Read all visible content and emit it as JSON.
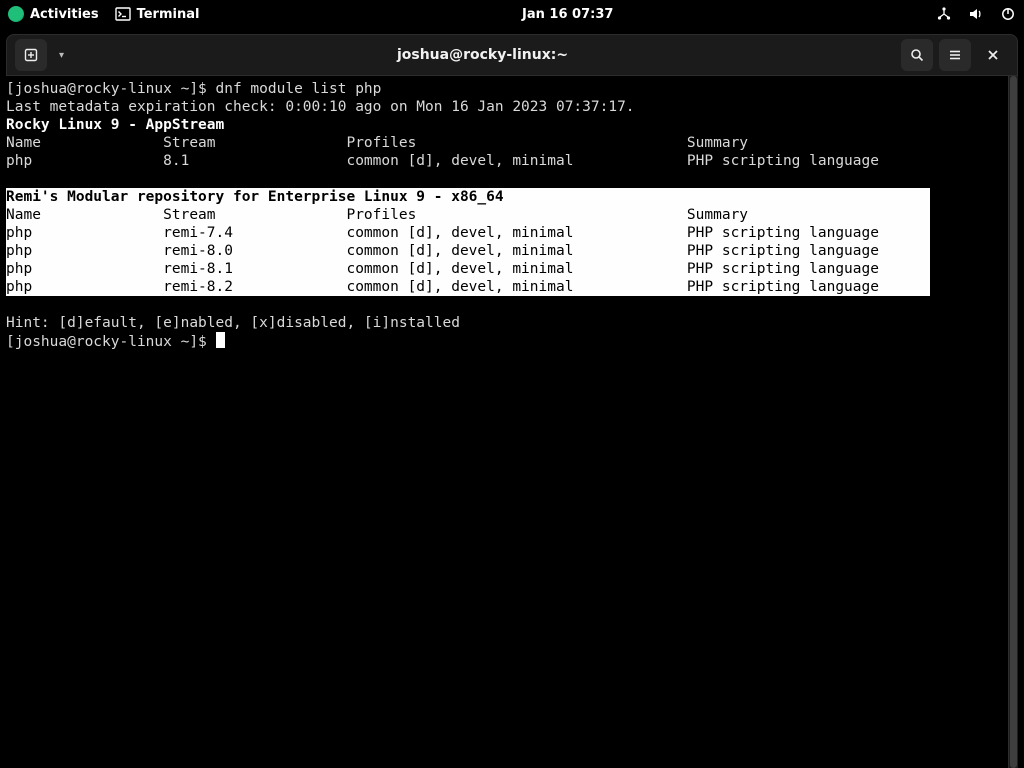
{
  "topbar": {
    "activities": "Activities",
    "terminal_label": "Terminal",
    "clock": "Jan 16  07:37"
  },
  "window": {
    "title": "joshua@rocky-linux:~"
  },
  "term": {
    "prompt": "[joshua@rocky-linux ~]$ ",
    "command": "dnf module list php",
    "meta_line": "Last metadata expiration check: 0:00:10 ago on Mon 16 Jan 2023 07:37:17.",
    "repo1_title": "Rocky Linux 9 - AppStream",
    "headers": {
      "name": "Name",
      "stream": "Stream",
      "profiles": "Profiles",
      "summary": "Summary"
    },
    "repo1_rows": [
      {
        "name": "php",
        "stream": "8.1",
        "profiles": "common [d], devel, minimal",
        "summary": "PHP scripting language"
      }
    ],
    "repo2_title": "Remi's Modular repository for Enterprise Linux 9 - x86_64",
    "repo2_rows": [
      {
        "name": "php",
        "stream": "remi-7.4",
        "profiles": "common [d], devel, minimal",
        "summary": "PHP scripting language"
      },
      {
        "name": "php",
        "stream": "remi-8.0",
        "profiles": "common [d], devel, minimal",
        "summary": "PHP scripting language"
      },
      {
        "name": "php",
        "stream": "remi-8.1",
        "profiles": "common [d], devel, minimal",
        "summary": "PHP scripting language"
      },
      {
        "name": "php",
        "stream": "remi-8.2",
        "profiles": "common [d], devel, minimal",
        "summary": "PHP scripting language"
      }
    ],
    "hint": "Hint: [d]efault, [e]nabled, [x]disabled, [i]nstalled",
    "cols": {
      "name": 18,
      "stream": 21,
      "profiles": 39
    }
  }
}
